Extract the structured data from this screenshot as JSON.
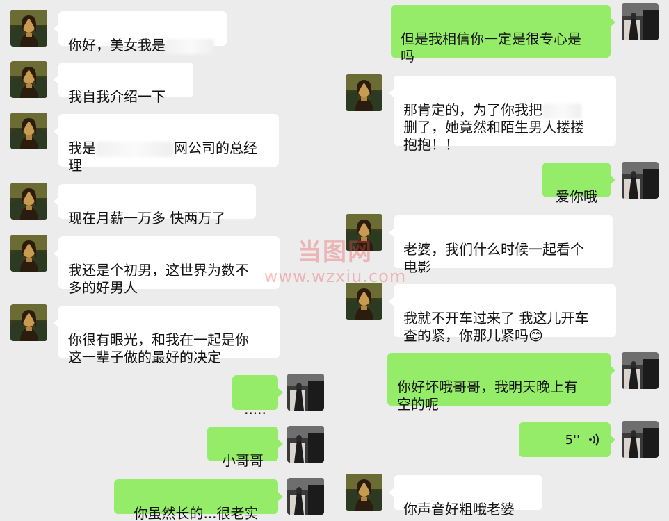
{
  "colors": {
    "background": "#ececec",
    "incoming_bubble": "#ffffff",
    "outgoing_bubble": "#95ec69"
  },
  "messages_left": [
    {
      "text": "你好，美女我是"
    },
    {
      "text": "我自我介绍一下"
    },
    {
      "text_before": "我是",
      "text_after": "网公司的总经\n理"
    },
    {
      "text": "现在月薪一万多 快两万了"
    },
    {
      "text": "我还是个初男，这世界为数不\n多的好男人"
    },
    {
      "text": "你很有眼光，和我在一起是你\n这一辈子做的最好的决定"
    },
    {
      "text": "....."
    },
    {
      "text": "小哥哥"
    },
    {
      "text": "你虽然长的...很老实"
    }
  ],
  "messages_right": [
    {
      "text": "但是我相信你一定是很专心是\n吗"
    },
    {
      "text_line1_before": "那肯定的，为了你我把",
      "text_rest": "删了，她竟然和陌生男人搂搂\n抱抱！！"
    },
    {
      "text": "爱你哦"
    },
    {
      "text": "老婆，我们什么时候一起看个\n电影"
    },
    {
      "text": "我就不开车过来了 我这儿开车\n查的紧，你那儿紧吗",
      "emoji": "😊"
    },
    {
      "text": "你好坏哦哥哥，我明天晚上有\n空的呢"
    },
    {
      "duration": "5''",
      "icon": "voice-wave-icon"
    },
    {
      "text": "你声音好粗哦老婆"
    }
  ],
  "watermark": {
    "logo": "当图网",
    "url": "www.wzxiu.com"
  }
}
